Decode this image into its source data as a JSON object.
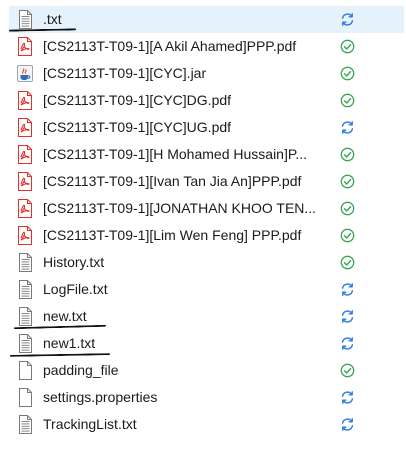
{
  "colors": {
    "selection_bg": "#e5f1fb",
    "sync_blue": "#2a7ae2",
    "check_green": "#3aa655",
    "pdf_red": "#e0312b",
    "text": "#1b1b1b"
  },
  "files": [
    {
      "name": ".txt",
      "type": "txt",
      "status": "syncing",
      "selected": true
    },
    {
      "name": "[CS2113T-T09-1][A Akil Ahamed]PPP.pdf",
      "type": "pdf",
      "status": "synced"
    },
    {
      "name": "[CS2113T-T09-1][CYC].jar",
      "type": "jar",
      "status": "synced"
    },
    {
      "name": "[CS2113T-T09-1][CYC]DG.pdf",
      "type": "pdf",
      "status": "synced"
    },
    {
      "name": "[CS2113T-T09-1][CYC]UG.pdf",
      "type": "pdf",
      "status": "syncing"
    },
    {
      "name": "[CS2113T-T09-1][H Mohamed Hussain]P...",
      "type": "pdf",
      "status": "synced"
    },
    {
      "name": "[CS2113T-T09-1][Ivan Tan Jia An]PPP.pdf",
      "type": "pdf",
      "status": "synced"
    },
    {
      "name": "[CS2113T-T09-1][JONATHAN KHOO TEN...",
      "type": "pdf",
      "status": "synced"
    },
    {
      "name": "[CS2113T-T09-1][Lim Wen Feng] PPP.pdf",
      "type": "pdf",
      "status": "synced"
    },
    {
      "name": "History.txt",
      "type": "txt",
      "status": "synced"
    },
    {
      "name": "LogFile.txt",
      "type": "txt",
      "status": "syncing"
    },
    {
      "name": "new.txt",
      "type": "txt",
      "status": "syncing"
    },
    {
      "name": "new1.txt",
      "type": "txt",
      "status": "syncing"
    },
    {
      "name": "padding_file",
      "type": "blank",
      "status": "synced"
    },
    {
      "name": "settings.properties",
      "type": "blank",
      "status": "syncing"
    },
    {
      "name": "TrackingList.txt",
      "type": "txt",
      "status": "syncing"
    }
  ]
}
